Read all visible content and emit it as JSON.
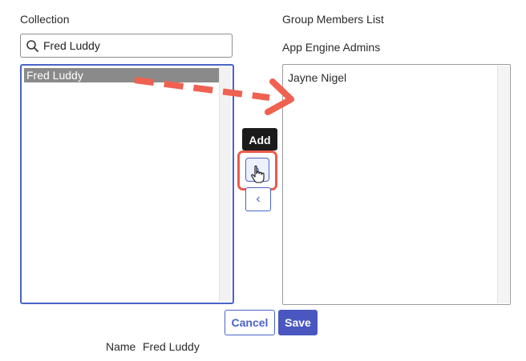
{
  "collection": {
    "label": "Collection",
    "search_value": "Fred Luddy",
    "items": [
      {
        "label": "Fred Luddy",
        "selected": true
      }
    ]
  },
  "group": {
    "label": "Group Members List",
    "name": "App Engine Admins",
    "members": [
      {
        "label": "Jayne Nigel"
      }
    ]
  },
  "controls": {
    "add_tooltip": "Add",
    "add_icon": "chevron-right-icon",
    "remove_icon": "chevron-left-icon"
  },
  "annotation": {
    "arrow_color": "#EF6150",
    "highlight_color": "#EA5B4C"
  },
  "footer": {
    "cancel_label": "Cancel",
    "save_label": "Save",
    "name_label": "Name",
    "name_value": "Fred Luddy"
  },
  "colors": {
    "accent": "#4A63C9",
    "save_bg": "#4A57C0",
    "selected_item_bg": "#8A8A8A"
  }
}
